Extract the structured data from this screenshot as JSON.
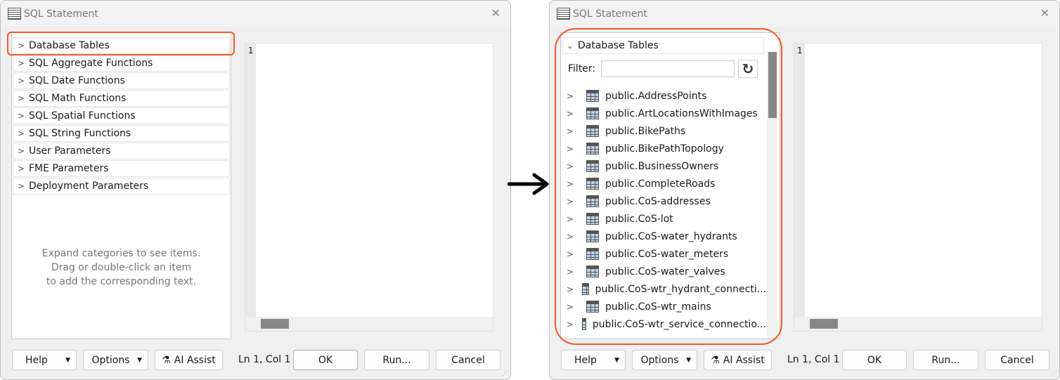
{
  "left_dialog": {
    "title": "SQL Statement",
    "categories": [
      "Database Tables",
      "SQL Aggregate Functions",
      "SQL Date Functions",
      "SQL Math Functions",
      "SQL Spatial Functions",
      "SQL String Functions",
      "User Parameters",
      "FME Parameters",
      "Deployment Parameters"
    ],
    "hint": [
      "Expand categories to see items.",
      "Drag or double-click an item",
      "to add the corresponding text."
    ],
    "line_number": "1",
    "buttons": {
      "help": "Help",
      "options": "Options",
      "ai_assist": "AI Assist",
      "ok": "OK",
      "run": "Run...",
      "cancel": "Cancel"
    },
    "cursor_position": "Ln 1, Col 1"
  },
  "right_dialog": {
    "title": "SQL Statement",
    "expanded_category": "Database Tables",
    "filter_label": "Filter:",
    "filter_value": "",
    "tables": [
      "public.AddressPoints",
      "public.ArtLocationsWithImages",
      "public.BikePaths",
      "public.BikePathTopology",
      "public.BusinessOwners",
      "public.CompleteRoads",
      "public.CoS-addresses",
      "public.CoS-lot",
      "public.CoS-water_hydrants",
      "public.CoS-water_meters",
      "public.CoS-water_valves",
      "public.CoS-wtr_hydrant_connecti...",
      "public.CoS-wtr_mains",
      "public.CoS-wtr_service_connectio..."
    ],
    "line_number": "1",
    "buttons": {
      "help": "Help",
      "options": "Options",
      "ai_assist": "AI Assist",
      "ok": "OK",
      "run": "Run...",
      "cancel": "Cancel"
    },
    "cursor_position": "Ln 1, Col 1"
  },
  "colors": {
    "highlight": "#f05a28"
  }
}
